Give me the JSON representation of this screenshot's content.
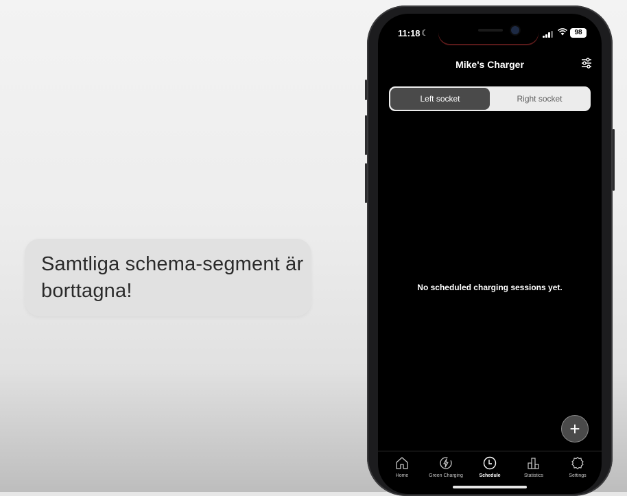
{
  "caption": {
    "text": "Samtliga schema-segment är borttagna!"
  },
  "status_bar": {
    "time": "11:18",
    "battery": "98",
    "icons": [
      "moon-icon",
      "signal-icon",
      "wifi-icon",
      "battery-icon"
    ]
  },
  "header": {
    "title": "Mike's Charger",
    "filter_icon": "filter-sliders-icon"
  },
  "socket_toggle": {
    "left_label": "Left socket",
    "right_label": "Right socket",
    "selected": "Left socket"
  },
  "empty_state": {
    "message": "No scheduled charging sessions yet."
  },
  "fab": {
    "icon": "plus-icon",
    "glyph": "+"
  },
  "tabs": [
    {
      "label": "Home",
      "icon": "home-icon"
    },
    {
      "label": "Green Charging",
      "icon": "green-charging-icon"
    },
    {
      "label": "Schedule",
      "icon": "clock-icon"
    },
    {
      "label": "Statistics",
      "icon": "statistics-icon"
    },
    {
      "label": "Settings",
      "icon": "gear-icon"
    }
  ],
  "active_tab": "Schedule",
  "colors": {
    "screen_bg": "#000000",
    "segment_active": "#4a4a4a",
    "segment_bg": "#ececec",
    "bubble_bg": "#e1e1e1"
  }
}
